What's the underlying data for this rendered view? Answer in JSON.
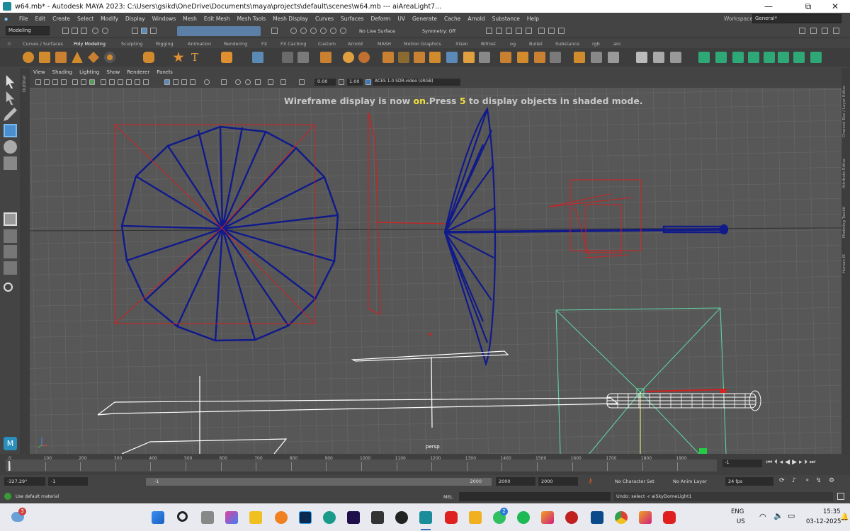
{
  "window": {
    "title": "w64.mb* - Autodesk MAYA 2023: C:\\Users\\gsikd\\OneDrive\\Documents\\maya\\projects\\default\\scenes\\w64.mb   ---   aiAreaLight7...",
    "minimize": "—",
    "maximize": "⧉",
    "close": "✕"
  },
  "menubar": {
    "items": [
      "File",
      "Edit",
      "Create",
      "Select",
      "Modify",
      "Display",
      "Windows",
      "Mesh",
      "Edit Mesh",
      "Mesh Tools",
      "Mesh Display",
      "Curves",
      "Surfaces",
      "Deform",
      "UV",
      "Generate",
      "Cache",
      "Arnold",
      "Substance",
      "Help"
    ],
    "workspace_label": "Workspace:",
    "workspace_value": "General*"
  },
  "status_line": {
    "mode": "Modeling",
    "live_surface": "No Live Surface",
    "symmetry": "Symmetry: Off"
  },
  "shelf_tabs": [
    "Curves / Surfaces",
    "Poly Modeling",
    "Sculpting",
    "Rigging",
    "Animation",
    "Rendering",
    "FX",
    "FX Caching",
    "Custom",
    "Arnold",
    "MASH",
    "Motion Graphics",
    "XGen",
    "Bifrost",
    "og",
    "Bullet",
    "Substance",
    "rgb",
    "ani"
  ],
  "shelf_active_tab": "Poly Modeling",
  "viewport_menu": [
    "View",
    "Shading",
    "Lighting",
    "Show",
    "Renderer",
    "Panels"
  ],
  "viewport_toolbar": {
    "exposure": "0.00",
    "gamma": "1.00",
    "color_space": "ACES 1.0 SDR-video (sRGB)"
  },
  "viewport": {
    "message_prefix": "Wireframe display is now ",
    "message_on": "on",
    "message_mid": ".Press ",
    "message_key": "5",
    "message_suffix": " to display objects in shaded mode.",
    "camera_label": "persp",
    "colors": {
      "grid": "#6a6a6a",
      "wire": "#101a8a",
      "light": "#d02020",
      "selected": "#5fd0a0",
      "white_wire": "#ffffff"
    }
  },
  "side_panels": [
    "Channel Box / Layer Editor",
    "Attribute Editor",
    "Modeling Toolkit",
    "Human IK"
  ],
  "outliner_tab": "Outliner",
  "timeline": {
    "ticks": [
      "0",
      "100",
      "200",
      "300",
      "400",
      "500",
      "600",
      "700",
      "800",
      "900",
      "1000",
      "1100",
      "1200",
      "1300",
      "1400",
      "1500",
      "1600",
      "1700",
      "1800",
      "1900"
    ],
    "current_frame": "1",
    "current_field": "-1"
  },
  "range": {
    "left_value": "-327.29°",
    "start": "-1",
    "slider_start": "-1",
    "slider_end": "2000",
    "end": "2000",
    "anim_end": "2000",
    "character_set": "No Character Set",
    "anim_layer": "No Anim Layer",
    "fps": "24 fps"
  },
  "command_line": {
    "help_text": "Use default material",
    "lang": "MEL",
    "result": "Undo: select -r aiSkyDomeLight1"
  },
  "taskbar": {
    "weather_badge": "3",
    "whatsapp_badge": "2",
    "lang_line1": "ENG",
    "lang_line2": "US",
    "time": "15:35",
    "date": "03-12-2025"
  }
}
